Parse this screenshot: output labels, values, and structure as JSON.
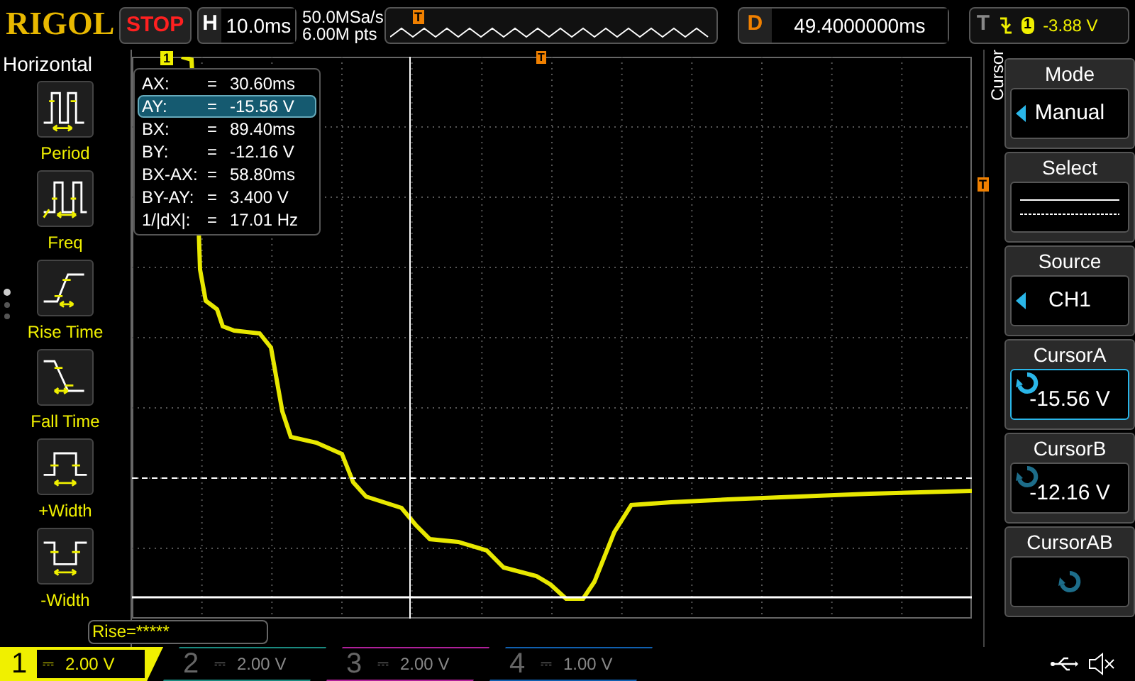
{
  "header": {
    "logo": "RIGOL",
    "run_state": "STOP",
    "timebase": {
      "label": "H",
      "value": "10.0ms"
    },
    "sample_rate": "50.0MSa/s",
    "memory_depth": "6.00M pts",
    "memory_marker": "T",
    "delay": {
      "label": "D",
      "value": "49.4000000ms"
    },
    "trigger": {
      "label": "T",
      "source": "1",
      "level": "-3.88 V"
    }
  },
  "left_menu": {
    "title": "Horizontal",
    "items": [
      {
        "kind": "period",
        "label": "Period"
      },
      {
        "kind": "freq",
        "label": "Freq"
      },
      {
        "kind": "rise",
        "label": "Rise Time"
      },
      {
        "kind": "fall",
        "label": "Fall Time"
      },
      {
        "kind": "pwidth",
        "label": "+Width"
      },
      {
        "kind": "nwidth",
        "label": "-Width"
      }
    ]
  },
  "screen": {
    "ch1_marker": "1",
    "trigger_position_marker": "T",
    "trigger_level_marker": "T",
    "cursor_readout": [
      {
        "label": "AX:",
        "sign": "=",
        "value": "30.60ms",
        "selected": false
      },
      {
        "label": "AY:",
        "sign": "=",
        "value": "-15.56 V",
        "selected": true
      },
      {
        "label": "BX:",
        "sign": "=",
        "value": "89.40ms",
        "selected": false
      },
      {
        "label": "BY:",
        "sign": "=",
        "value": "-12.16 V",
        "selected": false
      },
      {
        "label": "BX-AX:",
        "sign": "=",
        "value": "58.80ms",
        "selected": false
      },
      {
        "label": "BY-AY:",
        "sign": "=",
        "value": "3.400 V",
        "selected": false
      },
      {
        "label": "1/|dX|:",
        "sign": "=",
        "value": "17.01 Hz",
        "selected": false
      }
    ],
    "measurement": "Rise=*****"
  },
  "right_menu": {
    "title": "Cursor",
    "items": [
      {
        "kind": "option",
        "label": "Mode",
        "value": "Manual"
      },
      {
        "kind": "select",
        "label": "Select"
      },
      {
        "kind": "option",
        "label": "Source",
        "value": "CH1"
      },
      {
        "kind": "knob",
        "label": "CursorA",
        "value": "-15.56 V",
        "selected": true
      },
      {
        "kind": "knob",
        "label": "CursorB",
        "value": "-12.16 V",
        "selected": false
      },
      {
        "kind": "knob",
        "label": "CursorAB",
        "selected": false
      }
    ]
  },
  "channels": [
    {
      "number": "1",
      "coupling": "⎓",
      "scale": "2.00 V",
      "color": "#f0f000",
      "active": true
    },
    {
      "number": "2",
      "coupling": "⎓",
      "scale": "2.00 V",
      "color": "#1a8a80",
      "active": false
    },
    {
      "number": "3",
      "coupling": "⎓",
      "scale": "2.00 V",
      "color": "#b0209a",
      "active": false
    },
    {
      "number": "4",
      "coupling": "⎓",
      "scale": "1.00 V",
      "color": "#1060b0",
      "active": false
    }
  ]
}
